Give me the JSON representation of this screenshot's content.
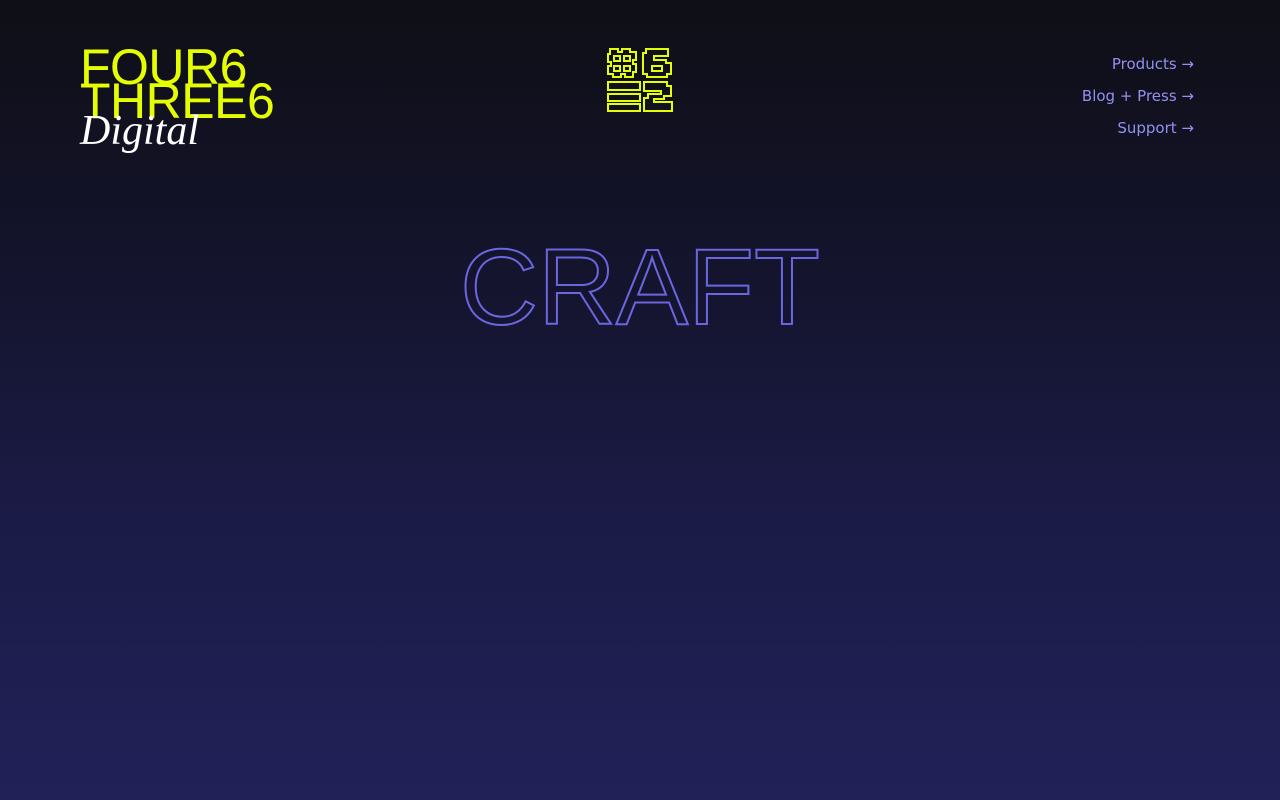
{
  "brand": {
    "line1": "FOUR6",
    "line2": "THREE6",
    "line3": "Digital"
  },
  "logo_mark": {
    "icon": "four6three6-pixel-monogram-icon",
    "color": "#e6ff00"
  },
  "nav": {
    "items": [
      {
        "label": "Products →"
      },
      {
        "label": "Blog + Press →"
      },
      {
        "label": "Support →"
      }
    ]
  },
  "hero": {
    "word": "CRAFT",
    "stroke_color": "#6b66e0"
  },
  "colors": {
    "accent_yellow": "#e6ff00",
    "nav_purple": "#9390f0",
    "background_top": "#0f0f16",
    "background_bottom": "#212158"
  }
}
